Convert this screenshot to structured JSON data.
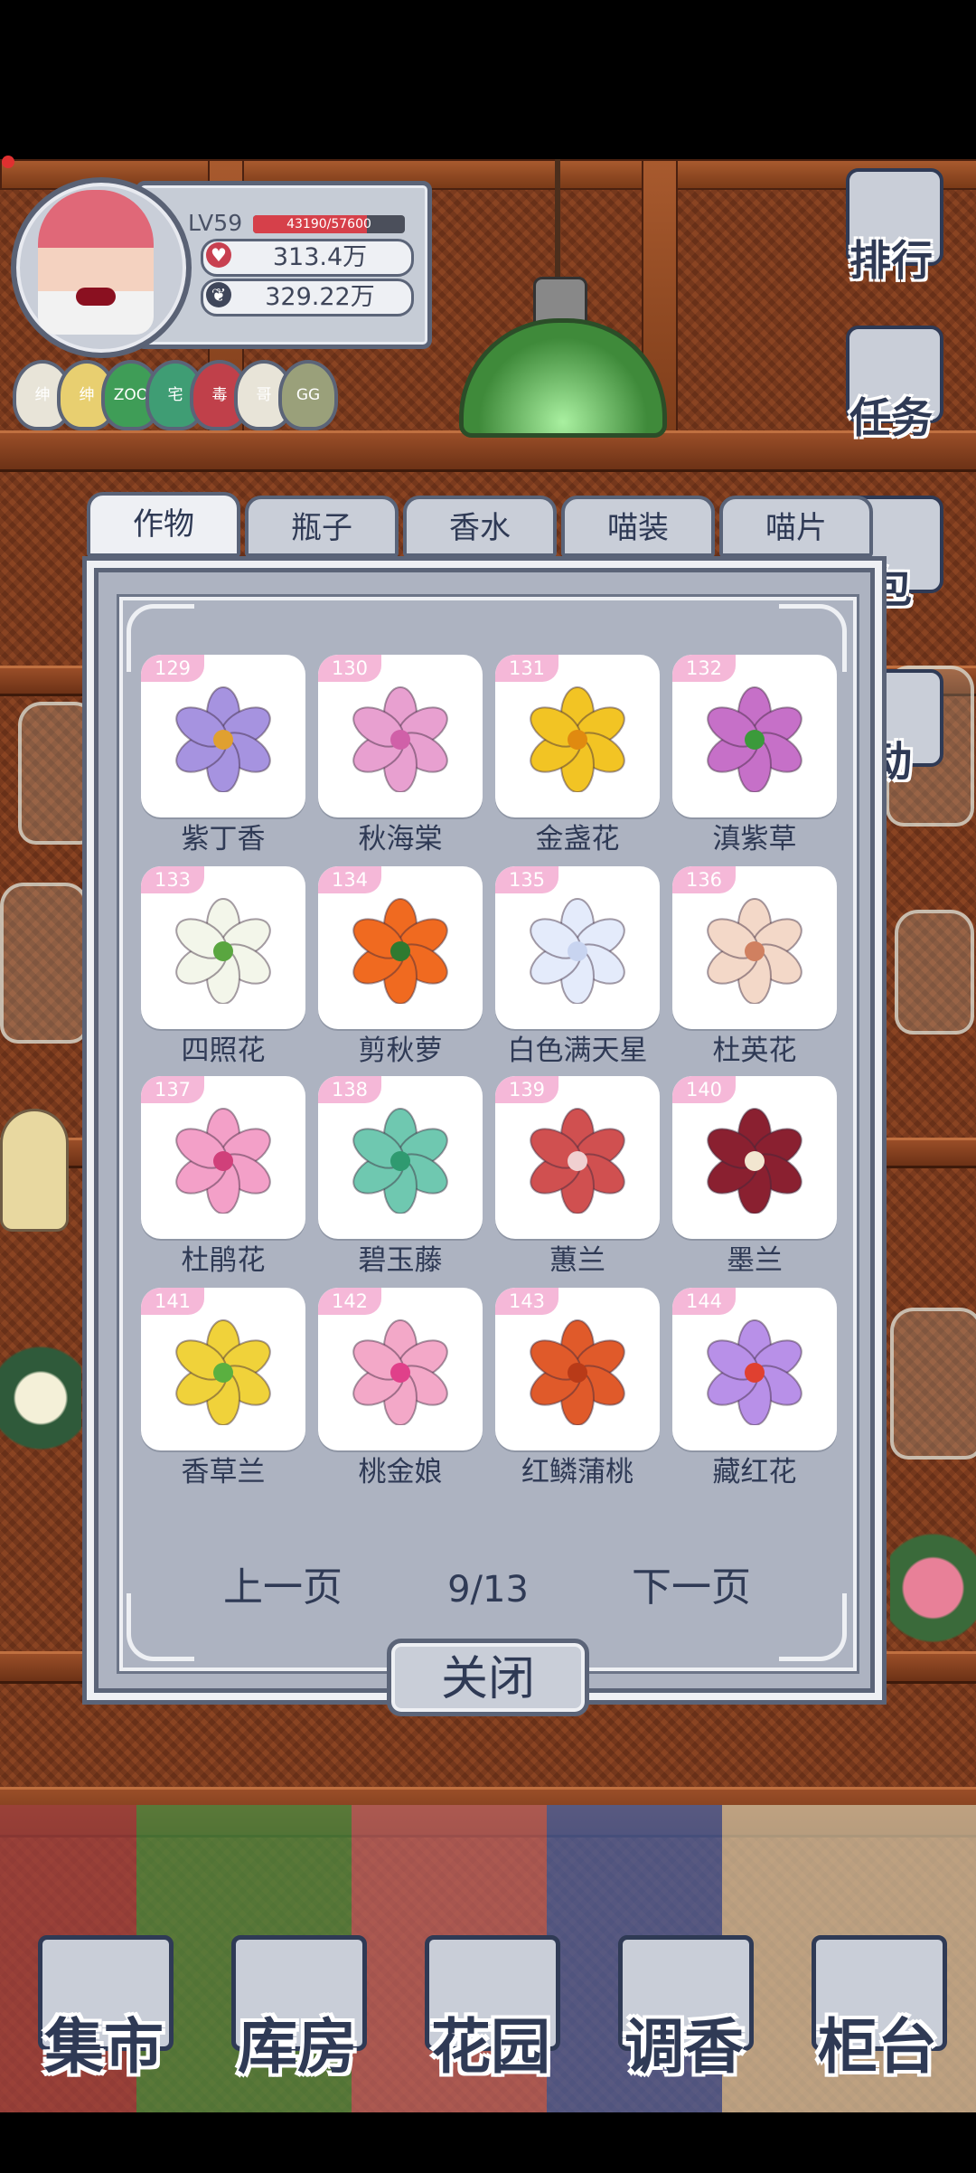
{
  "profile": {
    "level": "LV59",
    "xp_text": "43190/57600",
    "xp_fraction": 0.75,
    "currency_1": "313.4万",
    "currency_2": "329.22万",
    "badges": [
      {
        "label": "绅",
        "color": "#e8e4d8"
      },
      {
        "label": "绅",
        "color": "#e8cf70"
      },
      {
        "label": "ZOO",
        "color": "#3f9d57"
      },
      {
        "label": "宅",
        "color": "#3f9d74"
      },
      {
        "label": "毒",
        "color": "#c0404a"
      },
      {
        "label": "哥",
        "color": "#e8e4d8"
      },
      {
        "label": "GG",
        "color": "#9aa07a"
      }
    ]
  },
  "side_menu": [
    {
      "label": "排行",
      "icon": "trophy-icon"
    },
    {
      "label": "任务",
      "icon": "clipboard-icon"
    },
    {
      "label": "包",
      "icon": "bag-icon"
    },
    {
      "label": "动",
      "icon": "event-icon"
    }
  ],
  "tabs": [
    {
      "label": "作物",
      "active": true
    },
    {
      "label": "瓶子",
      "active": false
    },
    {
      "label": "香水",
      "active": false
    },
    {
      "label": "喵装",
      "active": false
    },
    {
      "label": "喵片",
      "active": false
    }
  ],
  "cards": [
    {
      "num": "129",
      "name": "紫丁香",
      "color": "#a693e0",
      "center": "#e0a030"
    },
    {
      "num": "130",
      "name": "秋海棠",
      "color": "#e8a0d0",
      "center": "#d060a8"
    },
    {
      "num": "131",
      "name": "金盏花",
      "color": "#f2c424",
      "center": "#e08a10"
    },
    {
      "num": "132",
      "name": "滇紫草",
      "color": "#c670c8",
      "center": "#3b9a3b"
    },
    {
      "num": "133",
      "name": "四照花",
      "color": "#f3f6ea",
      "center": "#5aa640"
    },
    {
      "num": "134",
      "name": "剪秋萝",
      "color": "#f06a20",
      "center": "#2f7a30"
    },
    {
      "num": "135",
      "name": "白色满天星",
      "color": "#e4ebfb",
      "center": "#c8d4f0"
    },
    {
      "num": "136",
      "name": "杜英花",
      "color": "#f3d8c8",
      "center": "#d08060"
    },
    {
      "num": "137",
      "name": "杜鹃花",
      "color": "#f3a0c8",
      "center": "#d0407a"
    },
    {
      "num": "138",
      "name": "碧玉藤",
      "color": "#6fc8b0",
      "center": "#2f9a70"
    },
    {
      "num": "139",
      "name": "蕙兰",
      "color": "#d05050",
      "center": "#f0d0d0"
    },
    {
      "num": "140",
      "name": "墨兰",
      "color": "#8a2030",
      "center": "#f2e6d0"
    },
    {
      "num": "141",
      "name": "香草兰",
      "color": "#f0d23a",
      "center": "#5ab040"
    },
    {
      "num": "142",
      "name": "桃金娘",
      "color": "#f3a8c8",
      "center": "#e0408a"
    },
    {
      "num": "143",
      "name": "红鳞蒲桃",
      "color": "#e05a2a",
      "center": "#b83a18"
    },
    {
      "num": "144",
      "name": "藏红花",
      "color": "#b890e8",
      "center": "#e04030"
    }
  ],
  "pager": {
    "prev": "上一页",
    "page": "9/13",
    "next": "下一页"
  },
  "close_label": "关闭",
  "bottom_nav": [
    {
      "label": "集市",
      "icon": "gate-icon"
    },
    {
      "label": "库房",
      "icon": "house-icon"
    },
    {
      "label": "花园",
      "icon": "rose-icon"
    },
    {
      "label": "调香",
      "icon": "perfume-icon"
    },
    {
      "label": "柜台",
      "icon": "counter-icon"
    }
  ]
}
